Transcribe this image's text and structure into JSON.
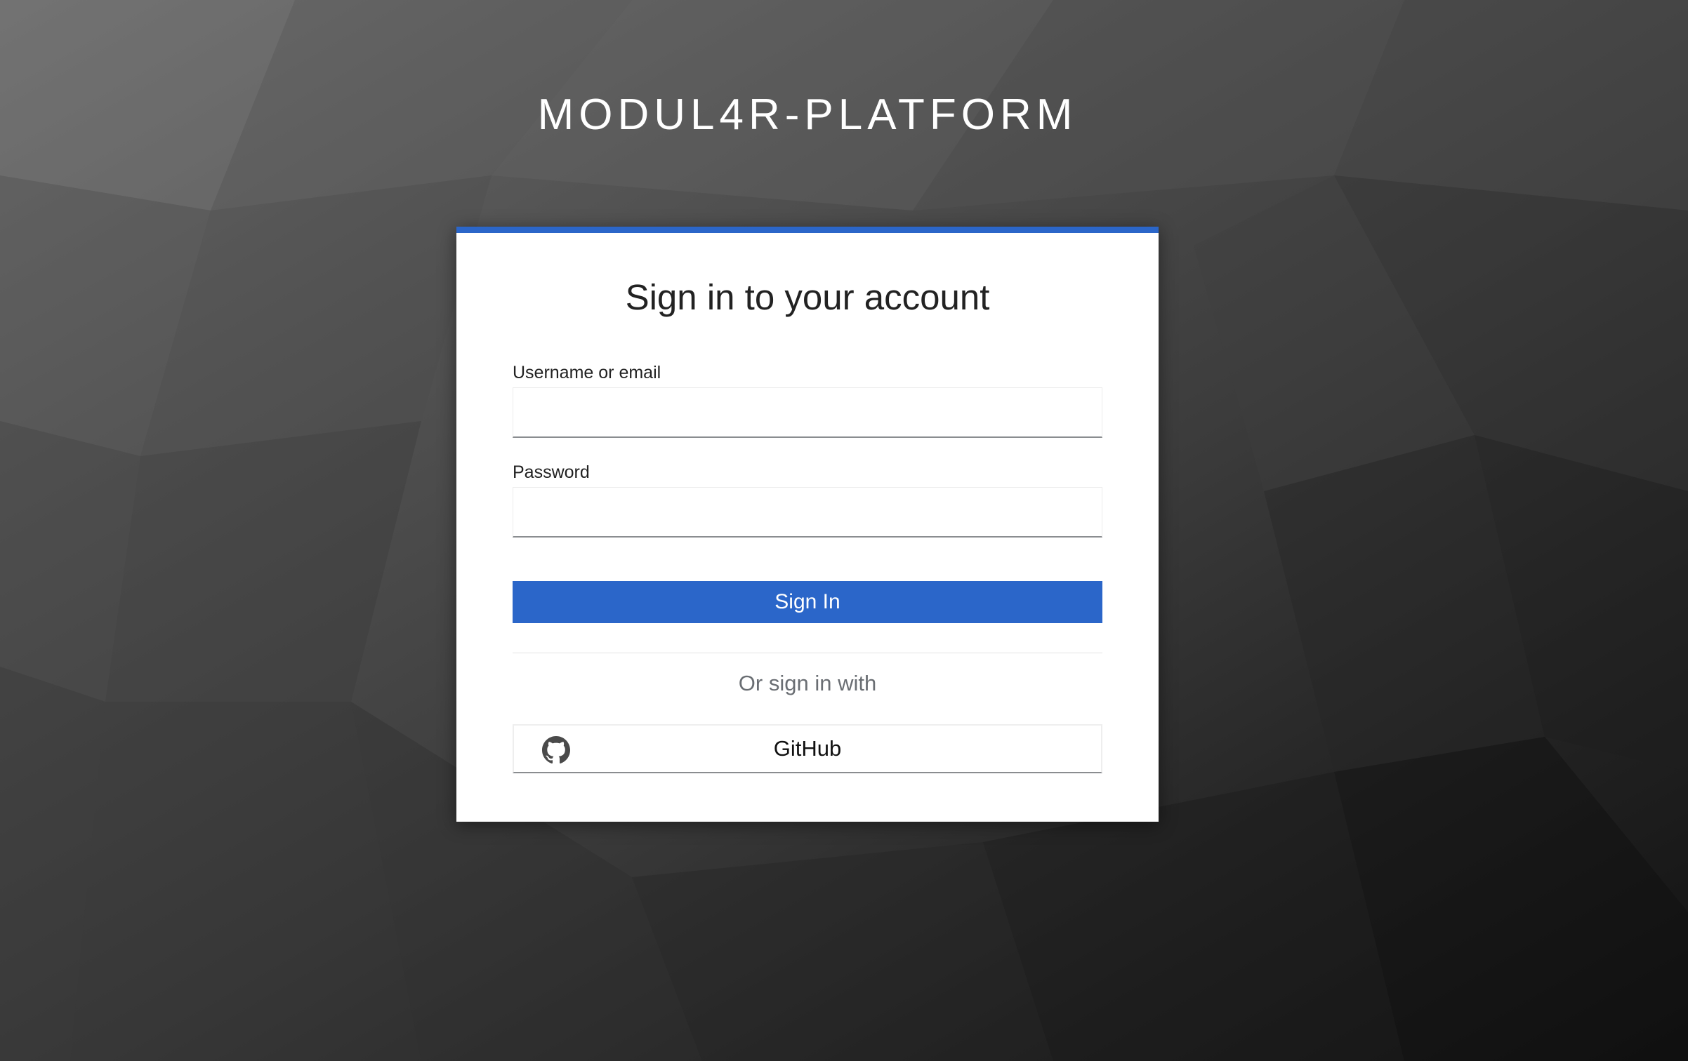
{
  "brand": {
    "title": "MODUL4R-PLATFORM"
  },
  "login": {
    "heading": "Sign in to your account",
    "username_label": "Username or email",
    "username_value": "",
    "password_label": "Password",
    "password_value": "",
    "signin_label": "Sign In",
    "alt_signin_text": "Or sign in with",
    "providers": [
      {
        "name": "GitHub",
        "icon": "github-icon"
      }
    ]
  },
  "colors": {
    "accent": "#2b66c9",
    "card_background": "#ffffff",
    "secondary_text": "#6a6e73"
  }
}
